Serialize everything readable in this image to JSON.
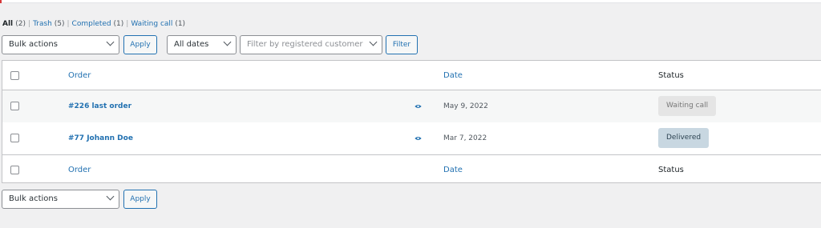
{
  "filters": {
    "all": {
      "label": "All",
      "count": "(2)"
    },
    "trash": {
      "label": "Trash",
      "count": "(5)"
    },
    "completed": {
      "label": "Completed",
      "count": "(1)"
    },
    "waiting": {
      "label": "Waiting call",
      "count": "(1)"
    },
    "separator": "|"
  },
  "toolbar_top": {
    "bulk_actions": "Bulk actions",
    "apply": "Apply",
    "all_dates": "All dates",
    "customer_placeholder": "Filter by registered customer",
    "filter": "Filter"
  },
  "table": {
    "columns": {
      "order": "Order",
      "date": "Date",
      "status": "Status"
    },
    "rows": [
      {
        "order": "#226 last order",
        "date": "May 9, 2022",
        "status": "Waiting call"
      },
      {
        "order": "#77 Johann Doe",
        "date": "Mar 7, 2022",
        "status": "Delivered"
      }
    ]
  },
  "toolbar_bottom": {
    "bulk_actions": "Bulk actions",
    "apply": "Apply"
  },
  "colors": {
    "link": "#2271b1",
    "waiting_bg": "#e5e5e5",
    "delivered_bg": "#c8d7e1"
  },
  "icons": {
    "preview": "eye-icon",
    "dropdown": "chevron-down-icon"
  }
}
